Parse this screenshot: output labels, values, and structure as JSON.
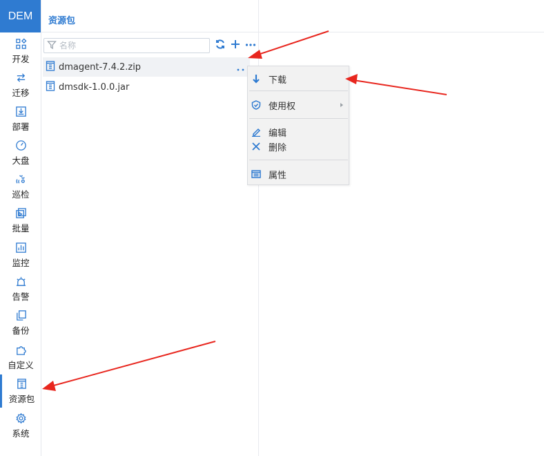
{
  "app": {
    "brand": "DEM"
  },
  "header": {
    "title": "资源包"
  },
  "nav": {
    "items": [
      {
        "label": "开发",
        "icon": "apps-grid-icon"
      },
      {
        "label": "迁移",
        "icon": "transfer-icon"
      },
      {
        "label": "部署",
        "icon": "deploy-icon"
      },
      {
        "label": "大盘",
        "icon": "dashboard-gauge-icon"
      },
      {
        "label": "巡检",
        "icon": "inspection-icon"
      },
      {
        "label": "批量",
        "icon": "batch-icon"
      },
      {
        "label": "监控",
        "icon": "monitor-chart-icon"
      },
      {
        "label": "告警",
        "icon": "alarm-siren-icon"
      },
      {
        "label": "备份",
        "icon": "backup-copy-icon"
      },
      {
        "label": "自定义",
        "icon": "puzzle-icon"
      },
      {
        "label": "资源包",
        "icon": "package-icon",
        "active": true
      },
      {
        "label": "系统",
        "icon": "gear-icon"
      }
    ]
  },
  "toolbar": {
    "filter_placeholder": "名称",
    "refresh_icon": "refresh-icon",
    "add_icon": "plus-icon",
    "more_icon": "more-dots-icon"
  },
  "files": [
    {
      "name": "dmagent-7.4.2.zip",
      "selected": true
    },
    {
      "name": "dmsdk-1.0.0.jar",
      "selected": false
    }
  ],
  "context_menu": {
    "items": [
      {
        "label": "下载",
        "icon": "download-arrow-icon"
      },
      {
        "label": "使用权",
        "icon": "shield-check-icon",
        "has_submenu": true
      },
      {
        "label": "编辑",
        "icon": "edit-pen-icon"
      },
      {
        "label": "删除",
        "icon": "close-x-icon"
      },
      {
        "label": "属性",
        "icon": "properties-window-icon"
      }
    ]
  },
  "colors": {
    "accent": "#2f7bd1",
    "annotation_arrow": "#e8261e",
    "menu_bg": "#f2f2f2",
    "selected_row_bg": "#f0f2f5"
  }
}
